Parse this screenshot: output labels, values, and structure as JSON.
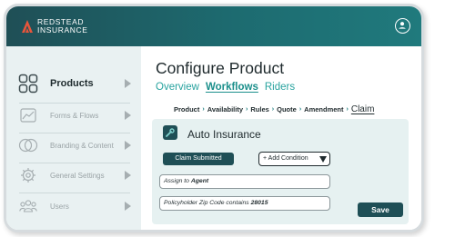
{
  "brand": {
    "name_line1": "REDSTEAD",
    "name_line2": "INSURANCE",
    "logo_color": "#e8553b"
  },
  "header": {
    "avatar_icon": "user-circle-icon"
  },
  "sidebar": {
    "items": [
      {
        "label": "Products",
        "icon": "grid-icon",
        "active": true
      },
      {
        "label": "Forms & Flows",
        "icon": "line-chart-icon",
        "active": false
      },
      {
        "label": "Branding & Content",
        "icon": "overlap-circles-icon",
        "active": false
      },
      {
        "label": "General Settings",
        "icon": "gear-icon",
        "active": false
      },
      {
        "label": "Users",
        "icon": "users-icon",
        "active": false
      }
    ]
  },
  "main": {
    "title": "Configure Product",
    "tabs": [
      {
        "label": "Overview",
        "active": false
      },
      {
        "label": "Workflows",
        "active": true
      },
      {
        "label": "Riders",
        "active": false
      }
    ],
    "steps": [
      "Product",
      "Availability",
      "Rules",
      "Quote",
      "Amendment",
      "Claim"
    ],
    "current_step": "Claim",
    "step_separator": "›",
    "card": {
      "title": "Auto Insurance",
      "icon": "wrench-icon",
      "trigger": "Claim Submitted",
      "add_condition": "+ Add Condition",
      "fields": [
        {
          "prefix": "Assign to ",
          "value": "Agent"
        },
        {
          "prefix": "Policyholder Zip Code contains ",
          "value": "28015"
        }
      ],
      "save": "Save"
    }
  },
  "colors": {
    "accent": "#28a39f",
    "dark_teal": "#1f4f56",
    "sidebar_bg": "#e9f1f2",
    "card_bg": "#e6f1f1"
  }
}
